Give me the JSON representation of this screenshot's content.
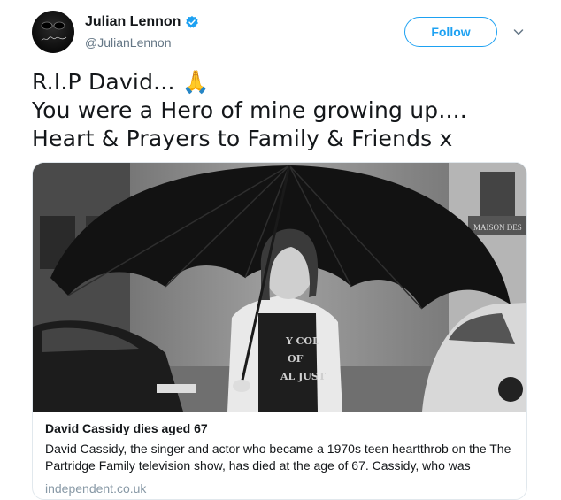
{
  "user": {
    "name": "Julian Lennon",
    "handle": "@JulianLennon",
    "verified": true,
    "avatar_signature": "Julian Lennon"
  },
  "follow_label": "Follow",
  "tweet_lines": [
    "R.I.P David... 🙏",
    "You were a Hero of mine growing up....",
    "Heart & Prayers to Family & Friends x"
  ],
  "card": {
    "image_text": {
      "shirt_line1": "Y COL",
      "shirt_line2": "OF",
      "shirt_line3": "AL JUST",
      "sign": "MAISON DES"
    },
    "title": "David Cassidy dies aged 67",
    "description": "David Cassidy, the singer and actor who became a 1970s teen heartthrob on the The Partridge Family television show, has died at the age of 67. Cassidy, who was",
    "domain": "independent.co.uk"
  },
  "colors": {
    "accent": "#1da1f2",
    "text": "#14171a",
    "secondary": "#657786",
    "border": "#e1e8ed"
  },
  "icons": {
    "verified": "verified-badge-icon",
    "caret": "chevron-down-icon"
  }
}
